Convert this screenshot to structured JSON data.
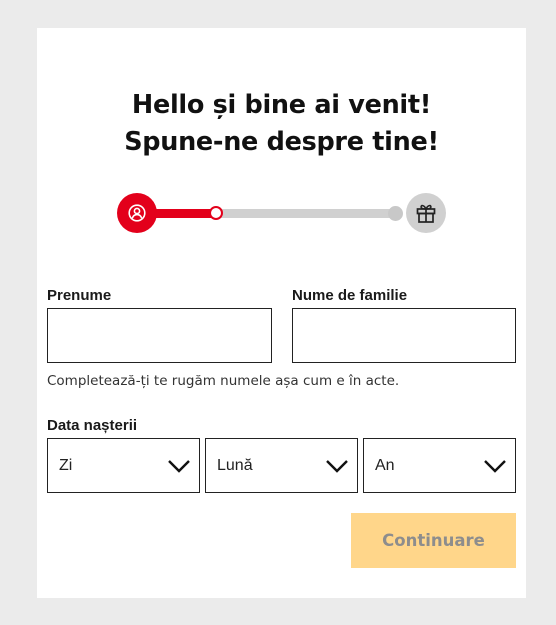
{
  "header": {
    "title_line1": "Hello și bine ai venit!",
    "title_line2": "Spune-ne despre tine!"
  },
  "stepper": {
    "start_icon": "user-icon",
    "end_icon": "gift-icon",
    "progress": 0.27,
    "active_color": "#e3001b",
    "inactive_color": "#d0d0d0"
  },
  "form": {
    "first_name": {
      "label": "Prenume",
      "value": ""
    },
    "last_name": {
      "label": "Nume de familie",
      "value": ""
    },
    "name_hint": "Completează-ți te rugăm numele așa cum e în acte.",
    "birth_date": {
      "label": "Data nașterii",
      "day": "Zi",
      "month": "Lună",
      "year": "An"
    },
    "submit_label": "Continuare"
  },
  "colors": {
    "accent": "#e3001b",
    "button_bg": "#ffd68a",
    "button_text": "#8d8d8d"
  }
}
